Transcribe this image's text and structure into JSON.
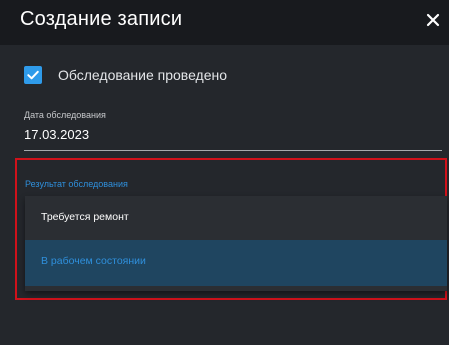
{
  "dialog": {
    "title": "Создание записи",
    "close_icon": "close-icon"
  },
  "inspection_checkbox": {
    "label": "Обследование проведено",
    "checked": true,
    "accent_color": "#2f9bea"
  },
  "date_field": {
    "label": "Дата обследования",
    "value": "17.03.2023"
  },
  "result_field": {
    "label": "Результат обследования",
    "highlight_color": "#d0121b",
    "options": [
      {
        "label": "Требуется ремонт",
        "selected": false
      },
      {
        "label": "В рабочем состоянии",
        "selected": true
      }
    ]
  },
  "colors": {
    "background": "#24272c",
    "header": "#181a1e",
    "selected_option": "#1f4560",
    "link_blue": "#2f8fdb"
  }
}
